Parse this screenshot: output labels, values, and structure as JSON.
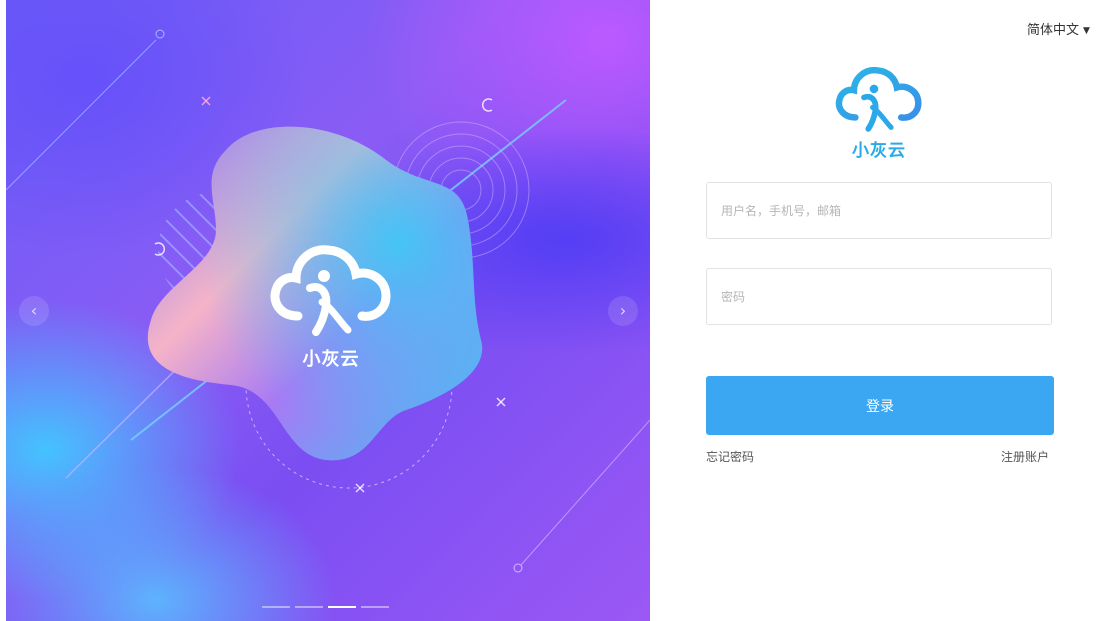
{
  "carousel": {
    "slide_logo_text": "小灰云",
    "prev_arrow": "‹",
    "next_arrow": "›",
    "indicator_count": 4,
    "active_indicator": 3
  },
  "header": {
    "language_label": "简体中文",
    "language_caret": "▼"
  },
  "brand": {
    "name": "小灰云",
    "color": "#2aa9ea"
  },
  "form": {
    "username_placeholder": "用户名，手机号，邮箱",
    "username_value": "",
    "password_placeholder": "密码",
    "password_value": "",
    "login_label": "登录",
    "forgot_label": "忘记密码",
    "register_label": "注册账户"
  },
  "colors": {
    "primary": "#3ba7f3",
    "hero_purple": "#8a5cf5",
    "hero_blue": "#40c8ff"
  }
}
